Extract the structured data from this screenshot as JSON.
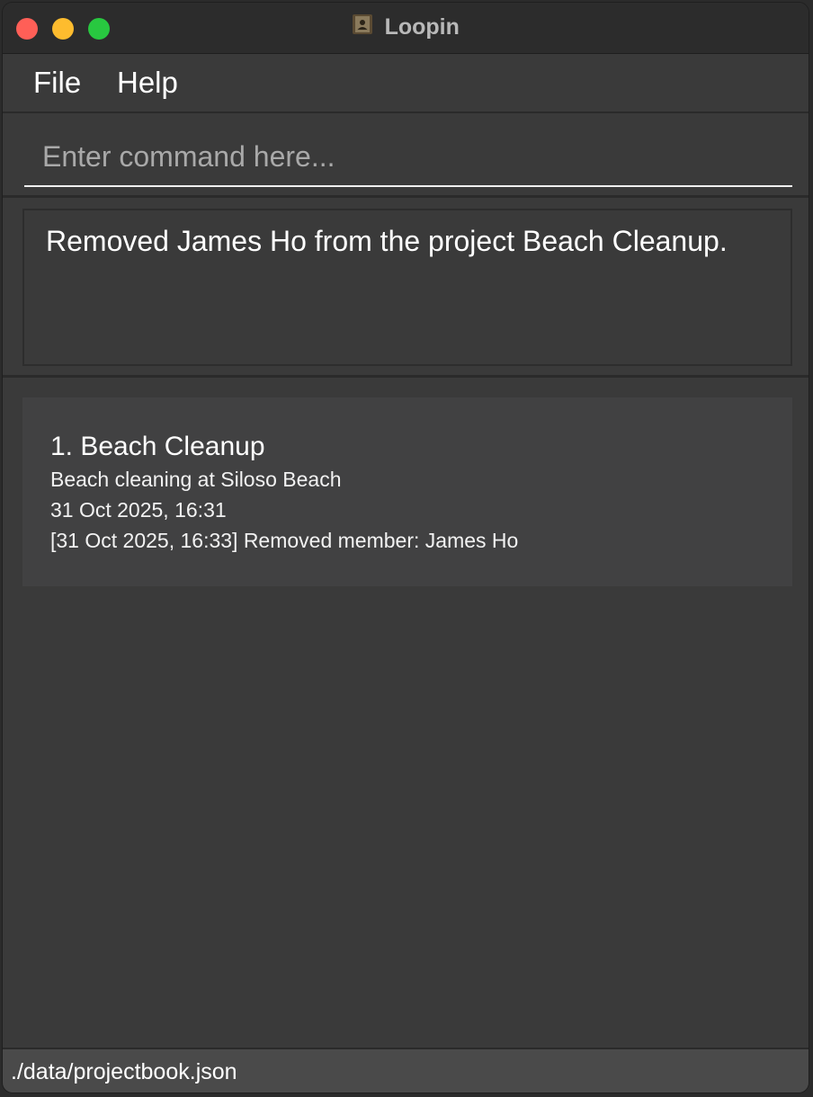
{
  "window": {
    "title": "Loopin",
    "icon": "contact-book-icon",
    "controls": [
      "close",
      "minimize",
      "zoom"
    ]
  },
  "menu": {
    "file_label": "File",
    "help_label": "Help"
  },
  "command": {
    "placeholder": "Enter command here...",
    "value": ""
  },
  "result": {
    "message": "Removed James Ho from the project Beach Cleanup."
  },
  "projects": [
    {
      "index_title": "1. Beach Cleanup",
      "description": "Beach cleaning at Siloso Beach",
      "created": "31 Oct 2025, 16:31",
      "log": "[31 Oct 2025, 16:33] Removed member: James Ho"
    }
  ],
  "status": {
    "file_path": "./data/projectbook.json"
  },
  "colors": {
    "close": "#ff5f57",
    "minimize": "#febc2e",
    "zoom": "#28c840",
    "background": "#3a3a3a",
    "card": "#414142"
  }
}
